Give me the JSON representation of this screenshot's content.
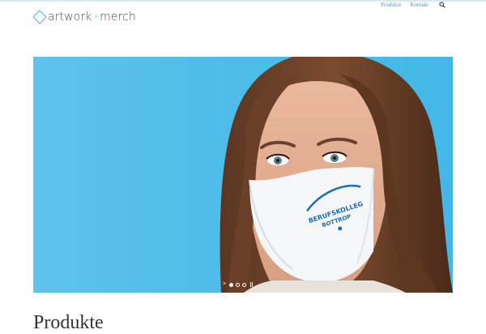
{
  "header": {
    "logo_text": "artwork",
    "logo_plus": "+",
    "logo_text_2": "merch",
    "nav": [
      {
        "label": "Produkte"
      },
      {
        "label": "Kontakt"
      }
    ],
    "search_icon": "search-icon"
  },
  "slider": {
    "mask_print_line1": "BERUFSKOLLEG",
    "mask_print_line2": "BOTTROP",
    "slide_count": 3,
    "active_slide": 1,
    "next_arrow": ">",
    "colors": {
      "background": "#4fbde8",
      "mask": "#f4f6f8",
      "print": "#1b6fb3"
    }
  },
  "main": {
    "section_title": "Produkte"
  }
}
